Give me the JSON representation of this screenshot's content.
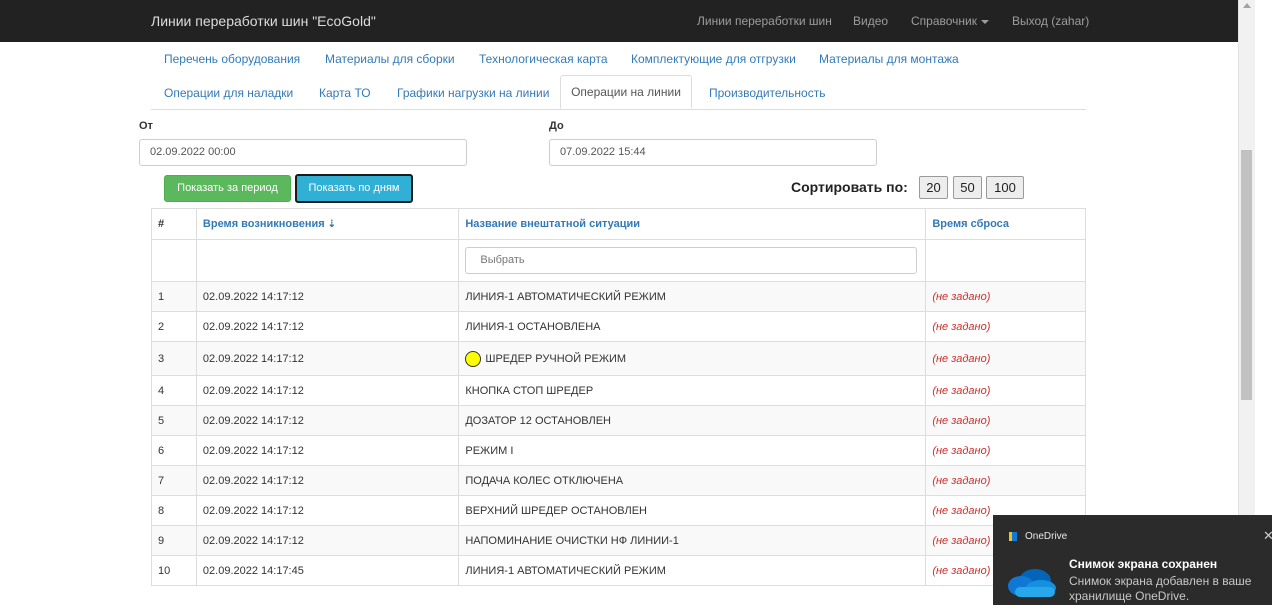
{
  "navbar": {
    "brand": "Линии переработки шин \"EcoGold\"",
    "links": [
      "Линии переработки шин",
      "Видео",
      "Справочник",
      "Выход (zahar)"
    ]
  },
  "tabs_row1": [
    "Перечень оборудования",
    "Материалы для сборки",
    "Технологическая карта",
    "Комплектующие для отгрузки",
    "Материалы для монтажа"
  ],
  "tabs_row2": [
    "Операции для наладки",
    "Карта ТО",
    "Графики нагрузки на линии",
    "Операции на линии",
    "Производительность"
  ],
  "filters": {
    "from_label": "От",
    "from_value": "02.09.2022 00:00",
    "to_label": "До",
    "to_value": "07.09.2022 15:44",
    "btn_period": "Показать за период",
    "btn_days": "Показать по дням",
    "sort_label": "Сортировать по:",
    "sort_options": [
      "20",
      "50",
      "100"
    ]
  },
  "table": {
    "headers": [
      "#",
      "Время возникновения",
      "Название внештатной ситуации",
      "Время сброса"
    ],
    "filter_placeholder": "Выбрать",
    "rows": [
      {
        "n": "1",
        "time": "02.09.2022 14:17:12",
        "name": "ЛИНИЯ-1 АВТОМАТИЧЕСКИЙ РЕЖИМ",
        "reset": "(не задано)"
      },
      {
        "n": "2",
        "time": "02.09.2022 14:17:12",
        "name": "ЛИНИЯ-1 ОСТАНОВЛЕНА",
        "reset": "(не задано)"
      },
      {
        "n": "3",
        "time": "02.09.2022 14:17:12",
        "name": "ШРЕДЕР РУЧНОЙ РЕЖИМ",
        "reset": "(не задано)"
      },
      {
        "n": "4",
        "time": "02.09.2022 14:17:12",
        "name": "КНОПКА СТОП ШРЕДЕР",
        "reset": "(не задано)"
      },
      {
        "n": "5",
        "time": "02.09.2022 14:17:12",
        "name": "ДОЗАТОР 12 ОСТАНОВЛЕН",
        "reset": "(не задано)"
      },
      {
        "n": "6",
        "time": "02.09.2022 14:17:12",
        "name": "РЕЖИМ I",
        "reset": "(не задано)"
      },
      {
        "n": "7",
        "time": "02.09.2022 14:17:12",
        "name": "ПОДАЧА КОЛЕС ОТКЛЮЧЕНА",
        "reset": "(не задано)"
      },
      {
        "n": "8",
        "time": "02.09.2022 14:17:12",
        "name": "ВЕРХНИЙ ШРЕДЕР ОСТАНОВЛЕН",
        "reset": "(не задано)"
      },
      {
        "n": "9",
        "time": "02.09.2022 14:17:12",
        "name": "НАПОМИНАНИЕ ОЧИСТКИ НФ ЛИНИИ-1",
        "reset": "(не задано)"
      },
      {
        "n": "10",
        "time": "02.09.2022 14:17:45",
        "name": "ЛИНИЯ-1 АВТОМАТИЧЕСКИЙ РЕЖИМ",
        "reset": "(не задано)"
      }
    ]
  },
  "toast": {
    "app": "OneDrive",
    "title": "Снимок экрана сохранен",
    "text": "Снимок экрана добавлен в ваше хранилище OneDrive.",
    "close": "✕"
  },
  "colors": {
    "navbar": "#222222",
    "link": "#337ab7",
    "green": "#5cb85c",
    "blue": "#31b0d5",
    "unset": "#c9302c"
  }
}
